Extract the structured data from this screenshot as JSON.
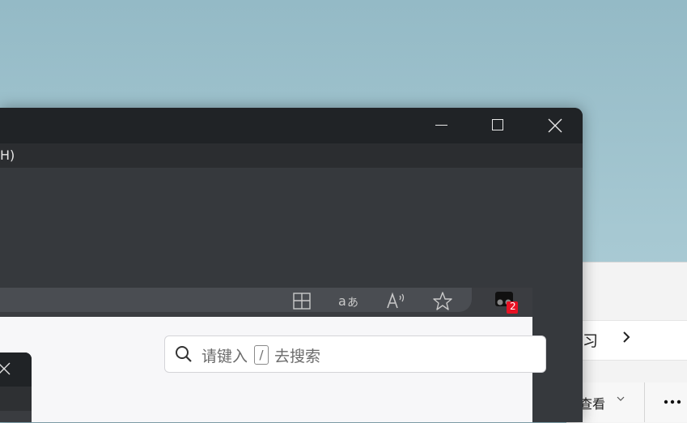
{
  "main_window": {
    "menu": {
      "help_fragment": "H)"
    },
    "controls": {
      "minimize": "minimize-icon",
      "maximize": "maximize-icon",
      "close": "close-icon"
    }
  },
  "browser": {
    "toolbar_icons": [
      "split-screen-icon",
      "translate-icon",
      "read-aloud-icon",
      "favorite-star-icon",
      "extension-icon"
    ],
    "extension_badge": "2",
    "search": {
      "placeholder_before": "请键入",
      "shortcut_key": "/",
      "placeholder_after": "去搜索"
    }
  },
  "explorer": {
    "nav_text": "习",
    "toolbar": {
      "view_label": "查看"
    }
  },
  "colors": {
    "desktop": "#a0c4cf",
    "window_dark": "#36393d",
    "titlebar": "#202326",
    "badge": "#e81123"
  }
}
